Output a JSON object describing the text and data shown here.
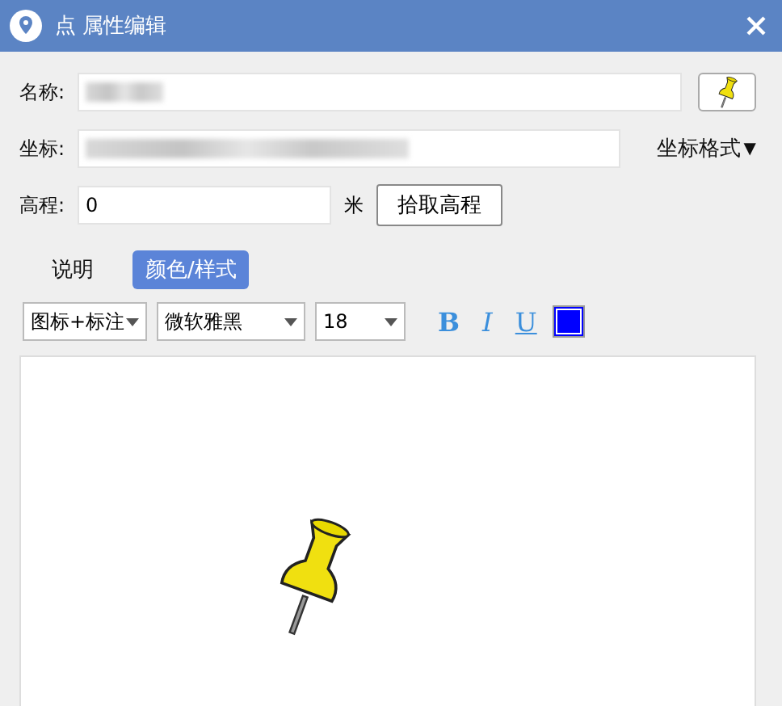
{
  "window": {
    "title": "点 属性编辑"
  },
  "name_row": {
    "label": "名称:"
  },
  "coord_row": {
    "label": "坐标:",
    "format_menu": "坐标格式",
    "menu_caret": "▼"
  },
  "elevation_row": {
    "label": "高程:",
    "value": "0",
    "unit": "米",
    "button": "拾取高程"
  },
  "tabs": [
    {
      "label": "说明",
      "selected": false
    },
    {
      "label": "颜色/样式",
      "selected": true
    }
  ],
  "toolbar": {
    "selects": [
      {
        "value": "图标+标注"
      },
      {
        "value": "微软雅黑"
      },
      {
        "value": "18"
      }
    ],
    "format_buttons": [
      {
        "label": "B",
        "kind": "bold"
      },
      {
        "label": "I",
        "kind": "italic"
      },
      {
        "label": "U",
        "kind": "underline"
      }
    ],
    "color": "#0000ff"
  }
}
